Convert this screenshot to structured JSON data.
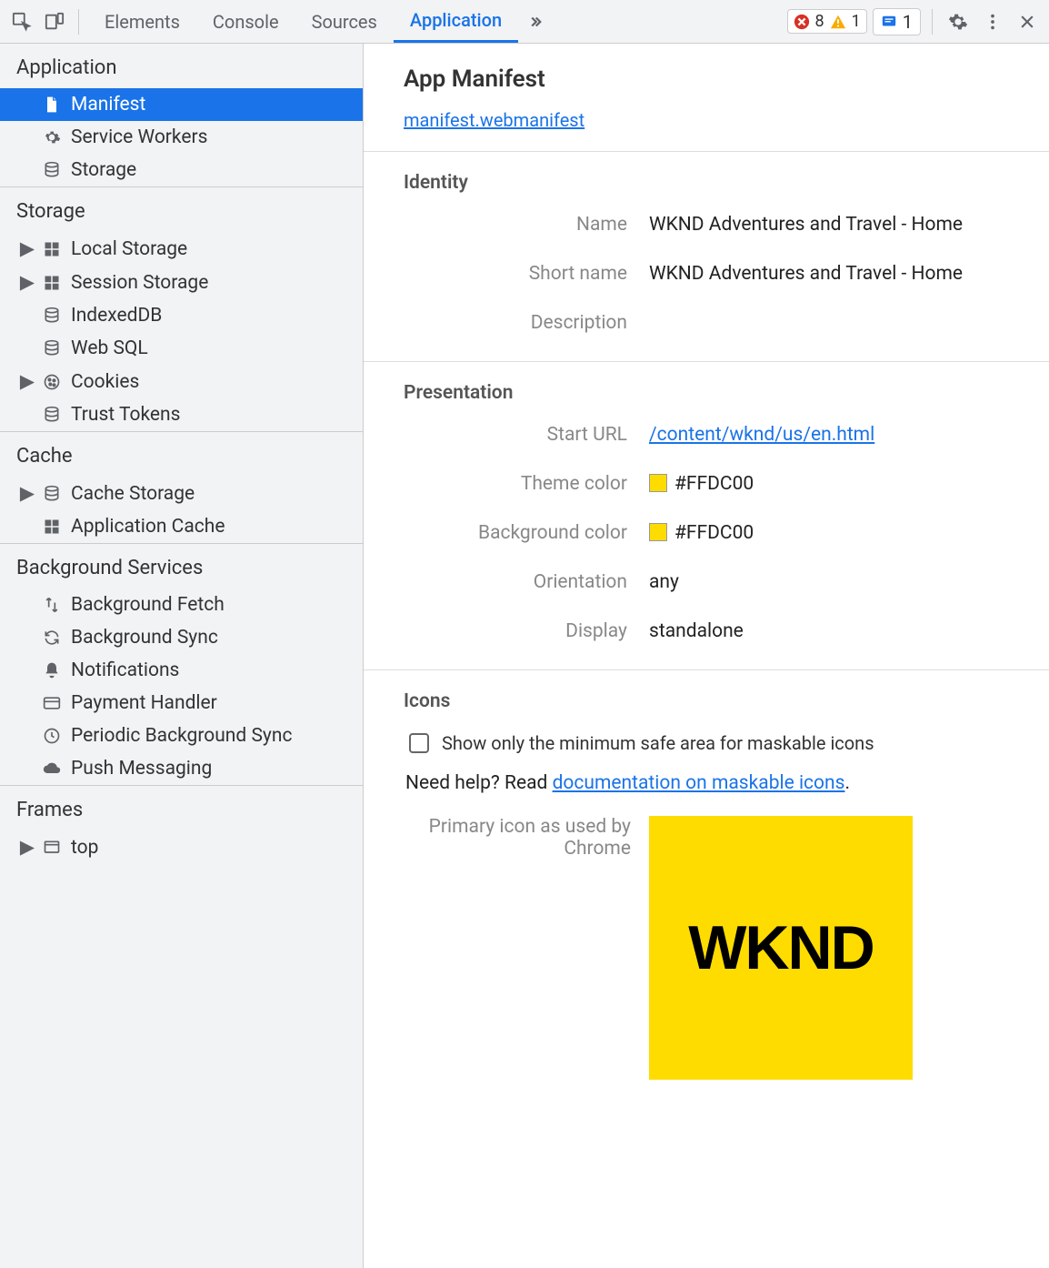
{
  "toolbar": {
    "tabs": [
      "Elements",
      "Console",
      "Sources",
      "Application"
    ],
    "active_tab": "Application",
    "errors": "8",
    "warnings": "1",
    "issues": "1"
  },
  "sidebar": {
    "sections": [
      {
        "title": "Application",
        "items": [
          {
            "label": "Manifest",
            "icon": "file",
            "active": true
          },
          {
            "label": "Service Workers",
            "icon": "gear"
          },
          {
            "label": "Storage",
            "icon": "database"
          }
        ]
      },
      {
        "title": "Storage",
        "items": [
          {
            "label": "Local Storage",
            "icon": "grid",
            "expandable": true
          },
          {
            "label": "Session Storage",
            "icon": "grid",
            "expandable": true
          },
          {
            "label": "IndexedDB",
            "icon": "database"
          },
          {
            "label": "Web SQL",
            "icon": "database"
          },
          {
            "label": "Cookies",
            "icon": "cookie",
            "expandable": true
          },
          {
            "label": "Trust Tokens",
            "icon": "database"
          }
        ]
      },
      {
        "title": "Cache",
        "items": [
          {
            "label": "Cache Storage",
            "icon": "database",
            "expandable": true
          },
          {
            "label": "Application Cache",
            "icon": "grid"
          }
        ]
      },
      {
        "title": "Background Services",
        "items": [
          {
            "label": "Background Fetch",
            "icon": "arrows"
          },
          {
            "label": "Background Sync",
            "icon": "sync"
          },
          {
            "label": "Notifications",
            "icon": "bell"
          },
          {
            "label": "Payment Handler",
            "icon": "card"
          },
          {
            "label": "Periodic Background Sync",
            "icon": "clock"
          },
          {
            "label": "Push Messaging",
            "icon": "cloud"
          }
        ]
      },
      {
        "title": "Frames",
        "items": [
          {
            "label": "top",
            "icon": "window",
            "expandable": true
          }
        ]
      }
    ]
  },
  "manifest": {
    "page_title": "App Manifest",
    "filename": "manifest.webmanifest",
    "identity_heading": "Identity",
    "name_label": "Name",
    "name_value": "WKND Adventures and Travel - Home",
    "short_name_label": "Short name",
    "short_name_value": "WKND Adventures and Travel - Home",
    "description_label": "Description",
    "description_value": "",
    "presentation_heading": "Presentation",
    "start_url_label": "Start URL",
    "start_url_value": "/content/wknd/us/en.html",
    "theme_color_label": "Theme color",
    "theme_color_value": "#FFDC00",
    "background_color_label": "Background color",
    "background_color_value": "#FFDC00",
    "orientation_label": "Orientation",
    "orientation_value": "any",
    "display_label": "Display",
    "display_value": "standalone",
    "icons_heading": "Icons",
    "maskable_checkbox_label": "Show only the minimum safe area for maskable icons",
    "help_prefix": "Need help? Read ",
    "help_link_text": "documentation on maskable icons",
    "help_suffix": ".",
    "primary_icon_label": "Primary icon as used by Chrome",
    "wknd_text": "WKND"
  }
}
